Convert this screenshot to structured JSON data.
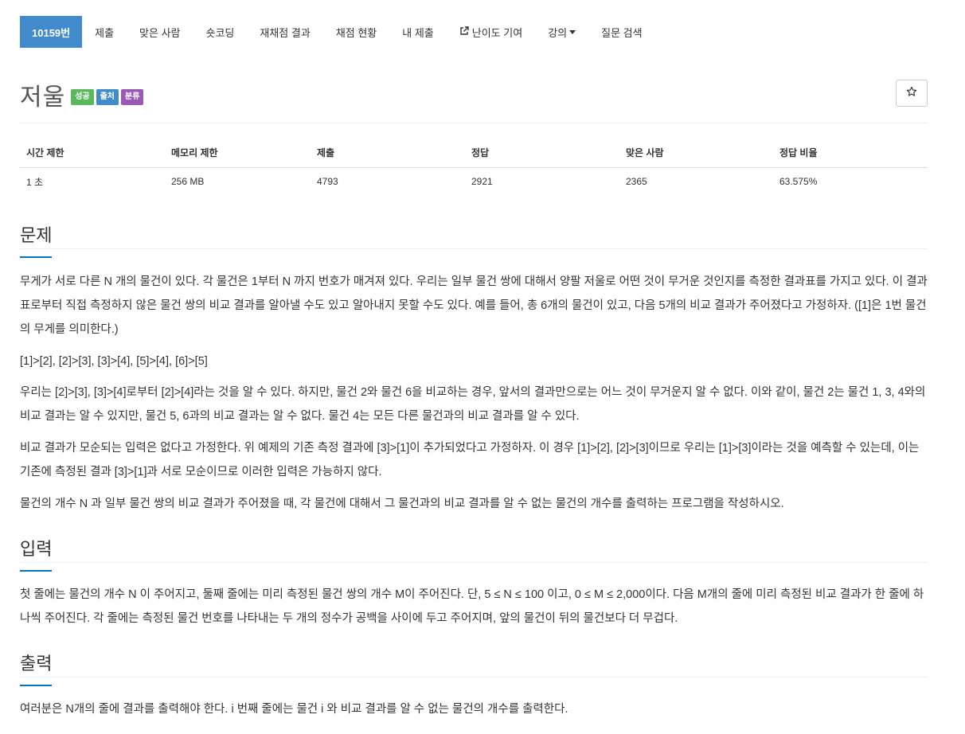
{
  "nav": {
    "items": [
      {
        "label": "10159번",
        "active": true
      },
      {
        "label": "제출"
      },
      {
        "label": "맞은 사람"
      },
      {
        "label": "숏코딩"
      },
      {
        "label": "재채점 결과"
      },
      {
        "label": "채점 현황"
      },
      {
        "label": "내 제출"
      },
      {
        "label": "난이도 기여",
        "icon": "external-link-icon"
      },
      {
        "label": "강의",
        "icon": "caret-down-icon"
      },
      {
        "label": "질문 검색"
      }
    ]
  },
  "problem": {
    "title": "저울",
    "labels": [
      "성공",
      "출처",
      "분류"
    ],
    "star_icon": "star-outline-icon"
  },
  "info_table": {
    "headers": [
      "시간 제한",
      "메모리 제한",
      "제출",
      "정답",
      "맞은 사람",
      "정답 비율"
    ],
    "values": [
      "1 초",
      "256 MB",
      "4793",
      "2921",
      "2365",
      "63.575%"
    ]
  },
  "sections": {
    "description": {
      "title": "문제",
      "paragraphs": [
        "무게가 서로 다른 N 개의 물건이 있다. 각 물건은 1부터 N 까지 번호가 매겨져 있다. 우리는 일부 물건 쌍에 대해서 양팔 저울로 어떤 것이 무거운 것인지를 측정한 결과표를 가지고 있다. 이 결과표로부터 직접 측정하지 않은 물건 쌍의 비교 결과를 알아낼 수도 있고 알아내지 못할 수도 있다. 예를 들어, 총 6개의 물건이 있고, 다음 5개의 비교 결과가 주어졌다고 가정하자. ([1]은 1번 물건의 무게를 의미한다.)",
        "[1]>[2], [2]>[3], [3]>[4], [5]>[4], [6]>[5]",
        "우리는 [2]>[3], [3]>[4]로부터 [2]>[4]라는 것을 알 수 있다. 하지만, 물건 2와 물건 6을 비교하는 경우, 앞서의 결과만으로는 어느 것이 무거운지 알 수 없다. 이와 같이, 물건 2는 물건 1, 3, 4와의 비교 결과는 알 수 있지만, 물건 5, 6과의 비교 결과는 알 수 없다. 물건 4는 모든 다른 물건과의 비교 결과를 알 수 있다.",
        "비교 결과가 모순되는 입력은 없다고 가정한다. 위 예제의 기존 측정 결과에 [3]>[1]이 추가되었다고 가정하자. 이 경우 [1]>[2], [2]>[3]이므로 우리는 [1]>[3]이라는 것을 예측할 수 있는데, 이는 기존에 측정된 결과 [3]>[1]과 서로 모순이므로 이러한 입력은 가능하지 않다.",
        "물건의 개수 N 과 일부 물건 쌍의 비교 결과가 주어졌을 때, 각 물건에 대해서 그 물건과의 비교 결과를 알 수 없는 물건의 개수를 출력하는 프로그램을 작성하시오."
      ]
    },
    "input": {
      "title": "입력",
      "paragraphs": [
        "첫 줄에는 물건의 개수 N 이 주어지고, 둘째 줄에는 미리 측정된 물건 쌍의 개수 M이 주어진다. 단, 5 ≤ N ≤ 100 이고, 0 ≤ M ≤ 2,000이다. 다음 M개의 줄에 미리 측정된 비교 결과가 한 줄에 하나씩 주어진다. 각 줄에는 측정된 물건 번호를 나타내는 두 개의 정수가 공백을 사이에 두고 주어지며, 앞의 물건이 뒤의 물건보다 더 무겁다."
      ]
    },
    "output": {
      "title": "출력",
      "paragraphs": [
        "여러분은 N개의 줄에 결과를 출력해야 한다. i 번째 줄에는 물건 i 와 비교 결과를 알 수 없는 물건의 개수를 출력한다."
      ]
    }
  },
  "colors": {
    "nav_active": "#428bca",
    "label_success": "#5cb85c",
    "label_source": "#428bca",
    "label_tag": "#9b59b6",
    "section_underline": "#0076c0"
  }
}
